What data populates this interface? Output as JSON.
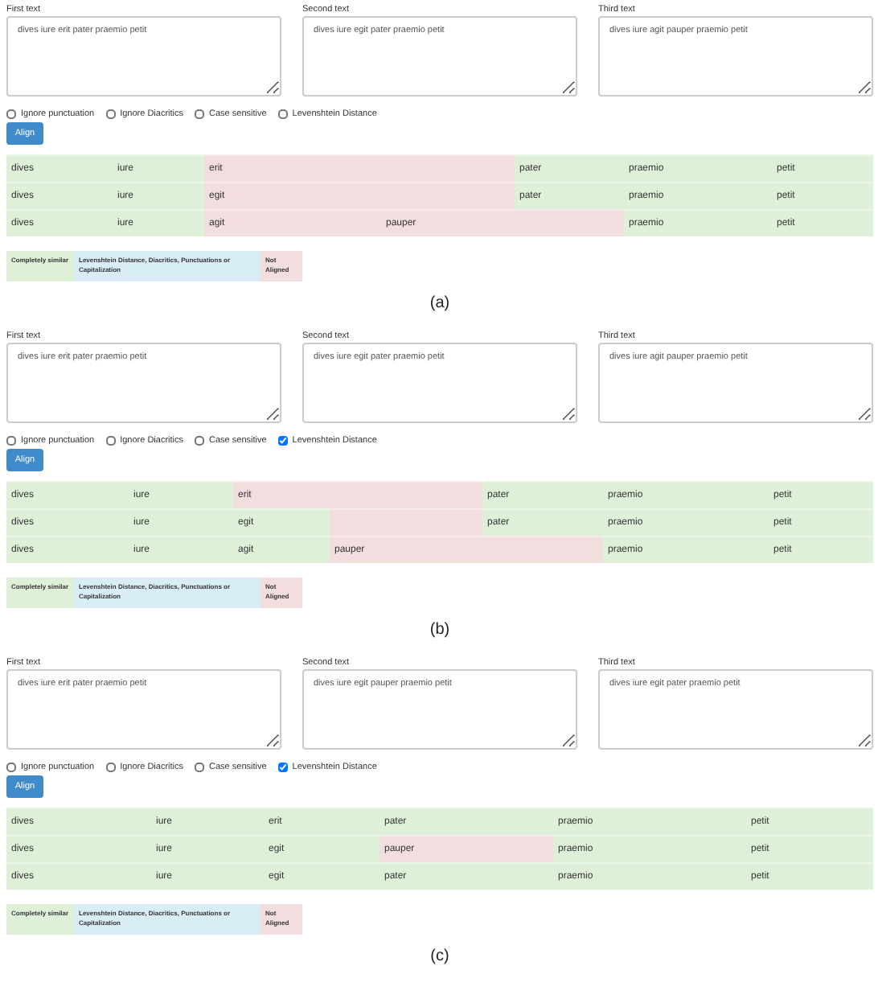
{
  "panels": [
    {
      "fields": [
        {
          "label": "First text",
          "value": "dives iure erit pater praemio petit"
        },
        {
          "label": "Second text",
          "value": "dives iure egit pater praemio petit"
        },
        {
          "label": "Third text",
          "value": "dives iure agit pauper praemio petit"
        }
      ],
      "options": [
        {
          "label": "Ignore punctuation",
          "checked": false
        },
        {
          "label": "Ignore Diacritics",
          "checked": false
        },
        {
          "label": "Case sensitive",
          "checked": false
        },
        {
          "label": "Levenshtein Distance",
          "checked": false
        }
      ],
      "button": "Align",
      "alignment": [
        [
          {
            "text": "dives",
            "aligned": true
          },
          {
            "text": "iure",
            "aligned": true
          },
          {
            "text": "erit",
            "aligned": false
          },
          {
            "text": "pater",
            "aligned": true
          },
          {
            "text": "praemio",
            "aligned": true
          },
          {
            "text": "petit",
            "aligned": true
          }
        ],
        [
          {
            "text": "dives",
            "aligned": true
          },
          {
            "text": "iure",
            "aligned": true
          },
          {
            "text": "egit",
            "aligned": false
          },
          {
            "text": "pater",
            "aligned": true
          },
          {
            "text": "praemio",
            "aligned": true
          },
          {
            "text": "petit",
            "aligned": true
          }
        ],
        [
          {
            "text": "dives",
            "aligned": true
          },
          {
            "text": "iure",
            "aligned": true
          },
          {
            "text": "agit",
            "aligned": false
          },
          {
            "text": "pauper",
            "aligned": false
          },
          {
            "text": "praemio",
            "aligned": true
          },
          {
            "text": "petit",
            "aligned": true
          }
        ]
      ],
      "legend": [
        {
          "label": "Completely similar",
          "color": "#dff0d8"
        },
        {
          "label": "Levenshtein Distance, Diacritics, Punctuations or Capitalization",
          "color": "#d9edf7"
        },
        {
          "label": "Not Aligned",
          "color": "#f2dede"
        }
      ],
      "caption": "(a)"
    },
    {
      "fields": [
        {
          "label": "First text",
          "value": "dives iure erit pater praemio petit"
        },
        {
          "label": "Second text",
          "value": "dives iure egit pater praemio petit"
        },
        {
          "label": "Third text",
          "value": "dives iure agit pauper praemio petit"
        }
      ],
      "options": [
        {
          "label": "Ignore punctuation",
          "checked": false
        },
        {
          "label": "Ignore Diacritics",
          "checked": false
        },
        {
          "label": "Case sensitive",
          "checked": false
        },
        {
          "label": "Levenshtein Distance",
          "checked": true
        }
      ],
      "button": "Align",
      "alignment": [
        [
          {
            "text": "dives",
            "aligned": true
          },
          {
            "text": "iure",
            "aligned": true
          },
          {
            "text": "erit",
            "aligned": false
          },
          {
            "text": "pater",
            "aligned": true
          },
          {
            "text": "praemio",
            "aligned": true
          },
          {
            "text": "petit",
            "aligned": true
          }
        ],
        [
          {
            "text": "dives",
            "aligned": true
          },
          {
            "text": "iure",
            "aligned": true
          },
          {
            "text": "egit",
            "aligned": true
          },
          {
            "aligned": false
          },
          {
            "text": "pater",
            "aligned": true
          },
          {
            "text": "praemio",
            "aligned": true
          },
          {
            "text": "petit",
            "aligned": true
          }
        ],
        [
          {
            "text": "dives",
            "aligned": true
          },
          {
            "text": "iure",
            "aligned": true
          },
          {
            "text": "agit",
            "aligned": true
          },
          {
            "text": "pauper",
            "aligned": false
          },
          {
            "text": "praemio",
            "aligned": true
          },
          {
            "text": "petit",
            "aligned": true
          }
        ]
      ],
      "legend": [
        {
          "label": "Completely similar",
          "color": "#dff0d8"
        },
        {
          "label": "Levenshtein Distance, Diacritics, Punctuations or Capitalization",
          "color": "#d9edf7"
        },
        {
          "label": "Not Aligned",
          "color": "#f2dede"
        }
      ],
      "caption": "(b)"
    },
    {
      "fields": [
        {
          "label": "First text",
          "value": "dives iure erit pater praemio petit"
        },
        {
          "label": "Second text",
          "value": "dives iure egit pauper praemio petit"
        },
        {
          "label": "Third text",
          "value": "dives iure egit pater praemio petit"
        }
      ],
      "options": [
        {
          "label": "Ignore punctuation",
          "checked": false
        },
        {
          "label": "Ignore Diacritics",
          "checked": false
        },
        {
          "label": "Case sensitive",
          "checked": false
        },
        {
          "label": "Levenshtein Distance",
          "checked": true
        }
      ],
      "button": "Align",
      "alignment": [
        [
          {
            "text": "dives",
            "aligned": true
          },
          {
            "text": "iure",
            "aligned": true
          },
          {
            "text": "erit",
            "aligned": true
          },
          {
            "text": "pater",
            "aligned": true
          },
          {
            "text": "praemio",
            "aligned": true
          },
          {
            "text": "petit",
            "aligned": true
          }
        ],
        [
          {
            "text": "dives",
            "aligned": true
          },
          {
            "text": "iure",
            "aligned": true
          },
          {
            "text": "egit",
            "aligned": true
          },
          {
            "text": "pauper",
            "aligned": false
          },
          {
            "text": "praemio",
            "aligned": true
          },
          {
            "text": "petit",
            "aligned": true
          }
        ],
        [
          {
            "text": "dives",
            "aligned": true
          },
          {
            "text": "iure",
            "aligned": true
          },
          {
            "text": "egit",
            "aligned": true
          },
          {
            "text": "pater",
            "aligned": true
          },
          {
            "text": "praemio",
            "aligned": true
          },
          {
            "text": "petit",
            "aligned": true
          }
        ]
      ],
      "legend": [
        {
          "label": "Completely similar",
          "color": "#dff0d8"
        },
        {
          "label": "Levenshtein Distance, Diacritics, Punctuations or Capitalization",
          "color": "#d9edf7"
        },
        {
          "label": "Not Aligned",
          "color": "#f2dede"
        }
      ],
      "caption": "(c)"
    }
  ]
}
